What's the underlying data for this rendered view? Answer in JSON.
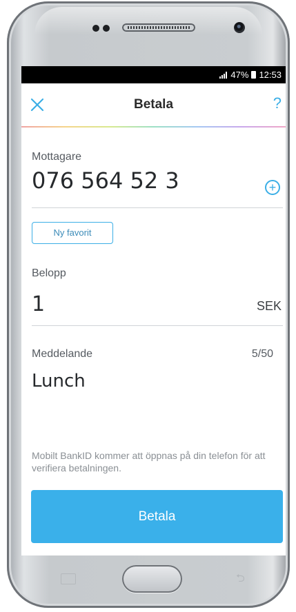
{
  "status_bar": {
    "battery_percent": "47%",
    "time": "12:53"
  },
  "app_bar": {
    "title": "Betala",
    "close_icon": "close-icon",
    "help_label": "?"
  },
  "recipient": {
    "label": "Mottagare",
    "value": "076 564 52 3",
    "add_icon": "plus-circle-icon"
  },
  "favorite_button": {
    "label": "Ny favorit"
  },
  "amount": {
    "label": "Belopp",
    "value": "1",
    "currency": "SEK"
  },
  "message": {
    "label": "Meddelande",
    "value": "Lunch",
    "counter": "5/50"
  },
  "info_text": "Mobilt BankID kommer att öppnas på din telefon för att verifiera betalningen.",
  "pay_button": {
    "label": "Betala"
  },
  "colors": {
    "accent": "#3ab0ea",
    "text_dark": "#26292c",
    "statusbar": "#000000"
  }
}
